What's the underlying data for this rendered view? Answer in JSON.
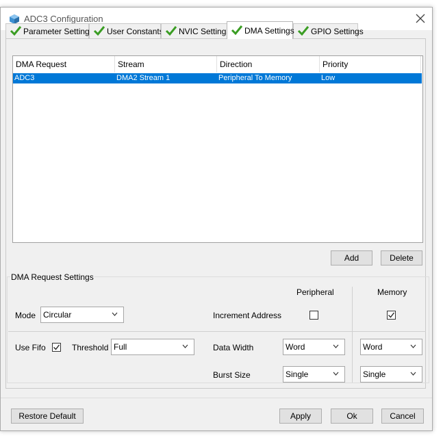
{
  "window": {
    "title": "ADC3 Configuration"
  },
  "tabs": [
    {
      "label": "Parameter Settings",
      "active": false
    },
    {
      "label": "User Constants",
      "active": false
    },
    {
      "label": "NVIC Settings",
      "active": false
    },
    {
      "label": "DMA Settings",
      "active": true
    },
    {
      "label": "GPIO Settings",
      "active": false
    }
  ],
  "dma_table": {
    "columns": [
      "DMA Request",
      "Stream",
      "Direction",
      "Priority"
    ],
    "rows": [
      {
        "request": "ADC3",
        "stream": "DMA2 Stream 1",
        "direction": "Peripheral To Memory",
        "priority": "Low",
        "selected": true
      }
    ]
  },
  "table_buttons": {
    "add": "Add",
    "delete": "Delete"
  },
  "settings": {
    "group_title": "DMA Request Settings",
    "peripheral_header": "Peripheral",
    "memory_header": "Memory",
    "mode_label": "Mode",
    "mode_value": "Circular",
    "increment_label": "Increment Address",
    "increment_peripheral": false,
    "increment_memory": true,
    "use_fifo_label": "Use Fifo",
    "use_fifo": true,
    "threshold_label": "Threshold",
    "threshold_value": "Full",
    "data_width_label": "Data Width",
    "data_width_peripheral": "Word",
    "data_width_memory": "Word",
    "burst_label": "Burst Size",
    "burst_peripheral": "Single",
    "burst_memory": "Single"
  },
  "footer": {
    "restore": "Restore Default",
    "apply": "Apply",
    "ok": "Ok",
    "cancel": "Cancel"
  },
  "colors": {
    "selection": "#0078d7",
    "check_green": "#3a9d23",
    "app_blue": "#1e90d8"
  }
}
